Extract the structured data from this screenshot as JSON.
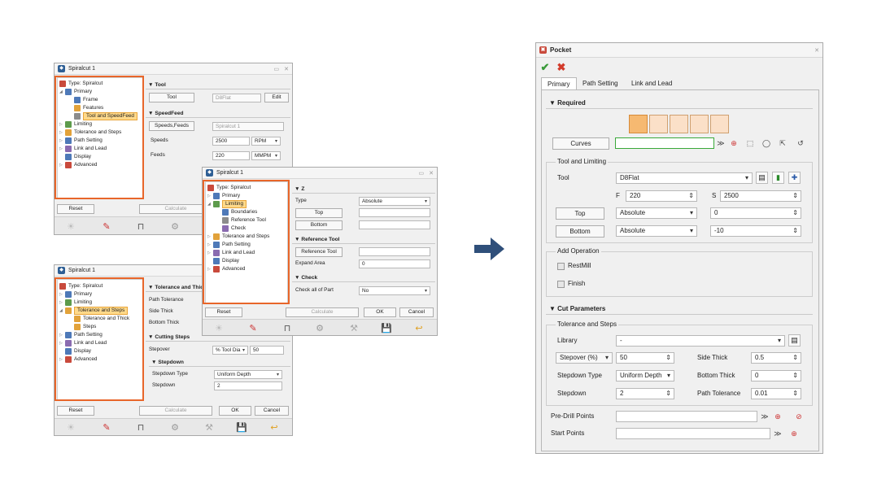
{
  "win1": {
    "title": "Spiralcut 1",
    "tree": [
      {
        "label": "Type: Spiralcut"
      },
      {
        "label": "Primary"
      },
      {
        "label": "Frame"
      },
      {
        "label": "Features"
      },
      {
        "label": "Tool and SpeedFeed"
      },
      {
        "label": "Limiting"
      },
      {
        "label": "Tolerance and Steps"
      },
      {
        "label": "Path Setting"
      },
      {
        "label": "Link and Lead"
      },
      {
        "label": "Display"
      },
      {
        "label": "Advanced"
      }
    ],
    "tool_section": "Tool",
    "tool_btn": "Tool",
    "tool_value": "D8Flat",
    "edit_btn": "Edit",
    "speedfeed_section": "SpeedFeed",
    "speedsfeeds_btn": "Speeds,Feeds",
    "speedsfeeds_value": "Spiralcut 1",
    "speeds_label": "Speeds",
    "speeds_value": "2500",
    "speeds_unit": "RPM",
    "feeds_label": "Feeds",
    "feeds_value": "220",
    "feeds_unit": "MMPM",
    "reset_btn": "Reset",
    "calculate_btn": "Calculate"
  },
  "win2": {
    "title": "Spiralcut 1",
    "tree": [
      {
        "label": "Type: Spiralcut"
      },
      {
        "label": "Primary"
      },
      {
        "label": "Limiting"
      },
      {
        "label": "Boundaries"
      },
      {
        "label": "Reference Tool"
      },
      {
        "label": "Check"
      },
      {
        "label": "Tolerance and Steps"
      },
      {
        "label": "Path Setting"
      },
      {
        "label": "Link and Lead"
      },
      {
        "label": "Display"
      },
      {
        "label": "Advanced"
      }
    ],
    "z_section": "Z",
    "type_label": "Type",
    "type_value": "Absolute",
    "top_btn": "Top",
    "bottom_btn": "Bottom",
    "reftool_section": "Reference Tool",
    "reftool_btn": "Reference Tool",
    "expand_label": "Expand Area",
    "expand_value": "0",
    "check_section": "Check",
    "checkall_label": "Check all of Part",
    "checkall_value": "No",
    "reset_btn": "Reset",
    "calculate_btn": "Calculate",
    "ok_btn": "OK",
    "cancel_btn": "Cancel"
  },
  "win3": {
    "title": "Spiralcut 1",
    "tree": [
      {
        "label": "Type: Spiralcut"
      },
      {
        "label": "Primary"
      },
      {
        "label": "Limiting"
      },
      {
        "label": "Tolerance and Steps"
      },
      {
        "label": "Tolerance and Thick"
      },
      {
        "label": "Steps"
      },
      {
        "label": "Path Setting"
      },
      {
        "label": "Link and Lead"
      },
      {
        "label": "Display"
      },
      {
        "label": "Advanced"
      }
    ],
    "tol_section": "Tolerance and Thic",
    "path_tol_label": "Path Tolerance",
    "side_thick_label": "Side Thick",
    "bottom_thick_label": "Bottom Thick",
    "cutting_section": "Cutting Steps",
    "stepover_label": "Stepover",
    "stepover_mode": "% Tool Dia",
    "stepover_value": "50",
    "stepdown_section": "Stepdown",
    "stepdown_type_label": "Stepdown Type",
    "stepdown_type_value": "Uniform Depth",
    "stepdown_label": "Stepdown",
    "stepdown_value": "2",
    "reset_btn": "Reset",
    "calculate_btn": "Calculate",
    "ok_btn": "OK",
    "cancel_btn": "Cancel"
  },
  "pocket": {
    "title": "Pocket",
    "tabs": [
      "Primary",
      "Path Setting",
      "Link and Lead"
    ],
    "required_section": "Required",
    "curves_btn": "Curves",
    "tool_limiting_group": "Tool and Limiting",
    "tool_label": "Tool",
    "tool_value": "D8Flat",
    "f_label": "F",
    "f_value": "220",
    "s_label": "S",
    "s_value": "2500",
    "top_btn": "Top",
    "top_mode": "Absolute",
    "top_value": "0",
    "bottom_btn": "Bottom",
    "bottom_mode": "Absolute",
    "bottom_value": "-10",
    "add_operation_group": "Add Operation",
    "restmill_label": "RestMill",
    "finish_label": "Finish",
    "cut_params_section": "Cut Parameters",
    "tol_steps_group": "Tolerance and Steps",
    "library_label": "Library",
    "library_value": "-",
    "stepover_mode": "Stepover (%)",
    "stepover_value": "50",
    "side_thick_label": "Side Thick",
    "side_thick_value": "0.5",
    "stepdown_type_label": "Stepdown Type",
    "stepdown_type_value": "Uniform Depth",
    "bottom_thick_label": "Bottom Thick",
    "bottom_thick_value": "0",
    "stepdown_label": "Stepdown",
    "stepdown_value": "2",
    "path_tol_label": "Path Tolerance",
    "path_tol_value": "0.01",
    "predrill_label": "Pre-Drill Points",
    "start_label": "Start Points"
  },
  "colors": {
    "highlight": "#e8662a",
    "arrow": "#2f4f7a",
    "ok_green": "#3a9a3a",
    "cancel_red": "#d23a2a"
  }
}
